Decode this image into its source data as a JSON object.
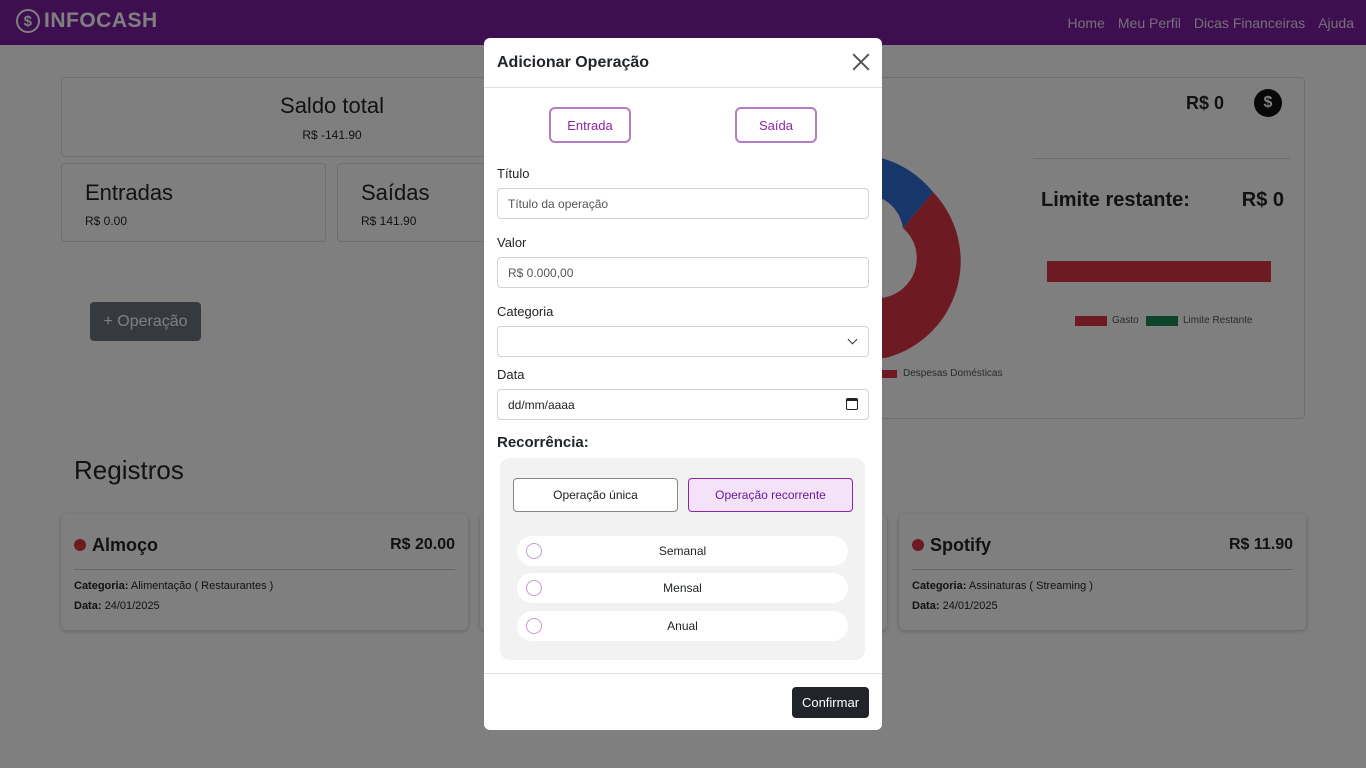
{
  "navbar": {
    "brand": "INFOCASH",
    "brand_logo_glyph": "$",
    "links": [
      "Home",
      "Meu Perfil",
      "Dicas Financeiras",
      "Ajuda"
    ]
  },
  "dashboard": {
    "saldo_title": "Saldo total",
    "saldo_value": "R$ -141.90",
    "entradas_title": "Entradas",
    "entradas_value": "R$ 0.00",
    "saidas_title": "Saídas",
    "saidas_value": "R$ 141.90",
    "operacao_button": "+ Operação",
    "right_panel": {
      "balance": "R$ 0",
      "limite_label": "Limite restante:",
      "limite_value": "R$ 0",
      "legend": [
        "Gasto",
        "Limite Restante"
      ],
      "donut_legend": "Despesas Domésticas",
      "donut_extra": "s"
    },
    "registros_title": "Registros",
    "records": [
      {
        "name": "Almoço",
        "amount": "R$ 20.00",
        "categoria_label": "Categoria:",
        "categoria": "Alimentação ( Restaurantes )",
        "data_label": "Data:",
        "data": "24/01/2025"
      },
      {
        "name": "Spotify",
        "amount": "R$ 11.90",
        "categoria_label": "Categoria:",
        "categoria": "Assinaturas ( Streaming )",
        "data_label": "Data:",
        "data": "24/01/2025"
      }
    ]
  },
  "modal": {
    "title": "Adicionar Operação",
    "entrada_button": "Entrada",
    "saida_button": "Saída",
    "titulo_label": "Título",
    "titulo_placeholder": "Título da operação",
    "valor_label": "Valor",
    "valor_placeholder": "R$ 0.000,00",
    "categoria_label": "Categoria",
    "categoria_value": "",
    "data_label": "Data",
    "data_placeholder": "dd/mm/aaaa",
    "recorrencia_label": "Recorrência:",
    "operacao_unica": "Operação única",
    "operacao_recorrente": "Operação recorrente",
    "options": [
      "Semanal",
      "Mensal",
      "Anual"
    ],
    "confirm_button": "Confirmar"
  },
  "colors": {
    "navbar": "#7a1fa2",
    "accent": "#8e24aa",
    "gasto": "#dc3545",
    "limite_restante": "#198754",
    "donut_blue": "#2f6fd6"
  }
}
